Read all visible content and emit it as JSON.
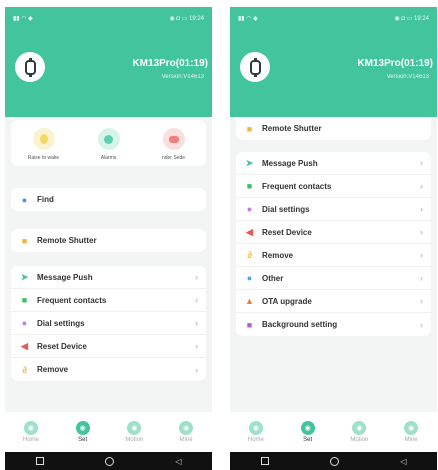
{
  "status_time": "19:24",
  "device": {
    "name": "KM13Pro(01:19)",
    "version": "Version:V14613"
  },
  "quick_actions": [
    {
      "label": "Raise to wake",
      "icon": "wake-icon",
      "color": "#f2d865"
    },
    {
      "label": "Alarms",
      "icon": "alarm-icon",
      "color": "#5fd1b0"
    },
    {
      "label": "nder   Sede",
      "icon": "sedentary-icon",
      "color": "#f08080"
    }
  ],
  "left_menu": {
    "find": "Find",
    "remote": "Remote Shutter",
    "items": [
      "Message Push",
      "Frequent contacts",
      "Dial settings",
      "Reset Device",
      "Remove"
    ]
  },
  "right_menu": {
    "remote": "Remote Shutter",
    "items": [
      "Message Push",
      "Frequent contacts",
      "Dial settings",
      "Reset Device",
      "Remove",
      "Other",
      "OTA upgrade",
      "Background setting"
    ]
  },
  "tabs": [
    "Home",
    "Set",
    "Motion",
    "Mine"
  ],
  "colors": {
    "header": "#42c49c",
    "accent": "#42c49c",
    "background": "#f3f5f4"
  }
}
